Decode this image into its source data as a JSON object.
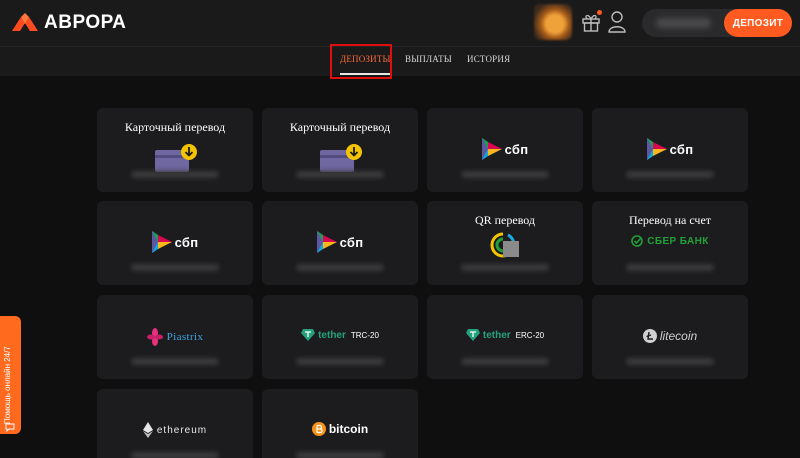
{
  "brand": {
    "name": "АВРОРА",
    "accent": "#ff5a1f"
  },
  "header": {
    "deposit_button": "ДЕПОЗИТ"
  },
  "tabs": [
    {
      "label": "ДЕПОЗИТЫ",
      "active": true
    },
    {
      "label": "ВЫПЛАТЫ",
      "active": false
    },
    {
      "label": "ИСТОРИЯ",
      "active": false
    }
  ],
  "methods": [
    {
      "title": "Карточный перевод",
      "icon": "card-download-icon"
    },
    {
      "title": "Карточный перевод",
      "icon": "card-download-icon"
    },
    {
      "title": "",
      "icon": "sbp-logo",
      "logo_text": "сбп"
    },
    {
      "title": "",
      "icon": "sbp-logo",
      "logo_text": "сбп"
    },
    {
      "title": "",
      "icon": "sbp-logo",
      "logo_text": "сбп"
    },
    {
      "title": "",
      "icon": "sbp-logo",
      "logo_text": "сбп"
    },
    {
      "title": "QR перевод",
      "icon": "qr-logo"
    },
    {
      "title": "Перевод на счет",
      "icon": "sber-logo",
      "logo_text": "СБЕР БАНК"
    },
    {
      "title": "",
      "icon": "piastrix-logo",
      "logo_text": "Piastrix"
    },
    {
      "title": "",
      "icon": "tether-logo",
      "logo_text": "tether",
      "network": "TRC-20"
    },
    {
      "title": "",
      "icon": "tether-logo",
      "logo_text": "tether",
      "network": "ERC-20"
    },
    {
      "title": "",
      "icon": "litecoin-logo",
      "logo_text": "litecoin"
    },
    {
      "title": "",
      "icon": "ethereum-logo",
      "logo_text": "ethereum"
    },
    {
      "title": "",
      "icon": "bitcoin-logo",
      "logo_text": "bitcoin"
    }
  ],
  "help": {
    "label": "Помощь онлайн 24/7"
  }
}
